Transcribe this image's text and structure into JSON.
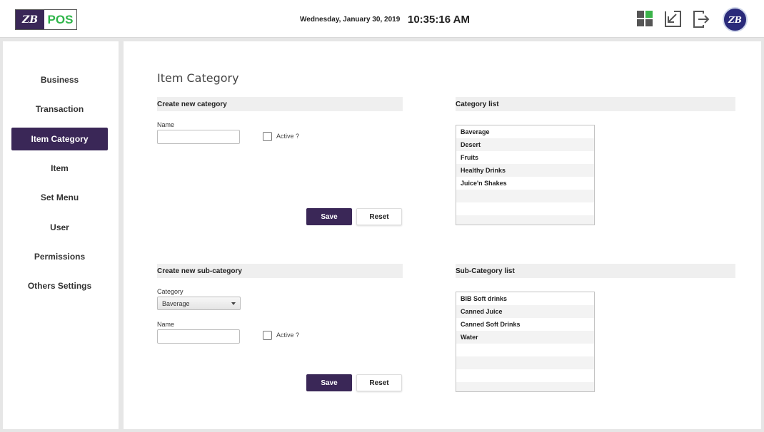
{
  "header": {
    "logo_mark": "ZB",
    "logo_text": "POS",
    "date": "Wednesday, January 30, 2019",
    "time": "10:35:16 AM",
    "icons": [
      "dashboard-grid-icon",
      "minimize-icon",
      "logout-icon"
    ],
    "avatar_text": "ZB"
  },
  "sidebar": {
    "items": [
      {
        "label": "Business"
      },
      {
        "label": "Transaction"
      },
      {
        "label": "Item Category",
        "active": true
      },
      {
        "label": "Item"
      },
      {
        "label": "Set Menu"
      },
      {
        "label": "User"
      },
      {
        "label": "Permissions"
      },
      {
        "label": "Others Settings"
      }
    ]
  },
  "main": {
    "title": "Item Category",
    "create_category": {
      "heading": "Create new category",
      "name_label": "Name",
      "name_value": "",
      "active_label": "Active ?",
      "save_label": "Save",
      "reset_label": "Reset"
    },
    "category_list": {
      "heading": "Category list",
      "items": [
        "Baverage",
        "Desert",
        "Fruits",
        "Healthy Drinks",
        "Juice'n Shakes",
        "",
        "",
        ""
      ]
    },
    "create_subcategory": {
      "heading": "Create new sub-category",
      "category_label": "Category",
      "category_selected": "Baverage",
      "name_label": "Name",
      "name_value": "",
      "active_label": "Active ?",
      "save_label": "Save",
      "reset_label": "Reset"
    },
    "subcategory_list": {
      "heading": "Sub-Category list",
      "items": [
        "BIB Soft drinks",
        "Canned Juice",
        "Canned Soft Drinks",
        "Water",
        "",
        "",
        "",
        ""
      ]
    }
  },
  "colors": {
    "accent": "#3a2757",
    "brand_green": "#2fb54a"
  }
}
